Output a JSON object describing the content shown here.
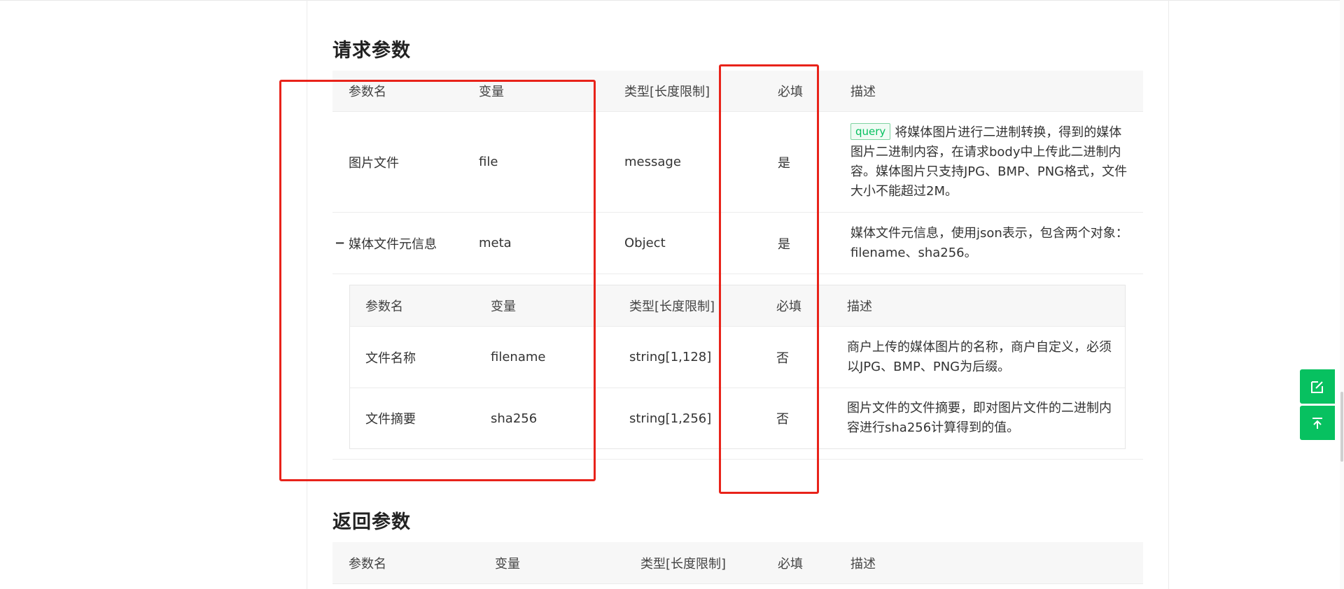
{
  "request_section": {
    "title": "请求参数",
    "columns": [
      "参数名",
      "变量",
      "类型[长度限制]",
      "必填",
      "描述"
    ],
    "rows": [
      {
        "name": "图片文件",
        "variable": "file",
        "type": "message",
        "required": "是",
        "tag": "query",
        "description": "将媒体图片进行二进制转换，得到的媒体图片二进制内容，在请求body中上传此二进制内容。媒体图片只支持JPG、BMP、PNG格式，文件大小不能超过2M。"
      },
      {
        "expand_icon": "−",
        "name": "媒体文件元信息",
        "variable": "meta",
        "type": "Object",
        "required": "是",
        "description": "媒体文件元信息，使用json表示，包含两个对象：filename、sha256。"
      }
    ],
    "subtable": {
      "columns": [
        "参数名",
        "变量",
        "类型[长度限制]",
        "必填",
        "描述"
      ],
      "rows": [
        {
          "name": "文件名称",
          "variable": "filename",
          "type": "string[1,128]",
          "required": "否",
          "description": "商户上传的媒体图片的名称，商户自定义，必须以JPG、BMP、PNG为后缀。"
        },
        {
          "name": "文件摘要",
          "variable": "sha256",
          "type": "string[1,256]",
          "required": "否",
          "description": "图片文件的文件摘要，即对图片文件的二进制内容进行sha256计算得到的值。"
        }
      ]
    }
  },
  "response_section": {
    "title": "返回参数",
    "columns": [
      "参数名",
      "变量",
      "类型[长度限制]",
      "必填",
      "描述"
    ]
  },
  "float_buttons": {
    "feedback_icon": "edit-icon",
    "top_icon": "back-to-top-icon"
  },
  "colors": {
    "accent": "#07c160",
    "annotation": "#e8231a",
    "header_bg": "#f7f7f7",
    "border": "#ececec"
  }
}
